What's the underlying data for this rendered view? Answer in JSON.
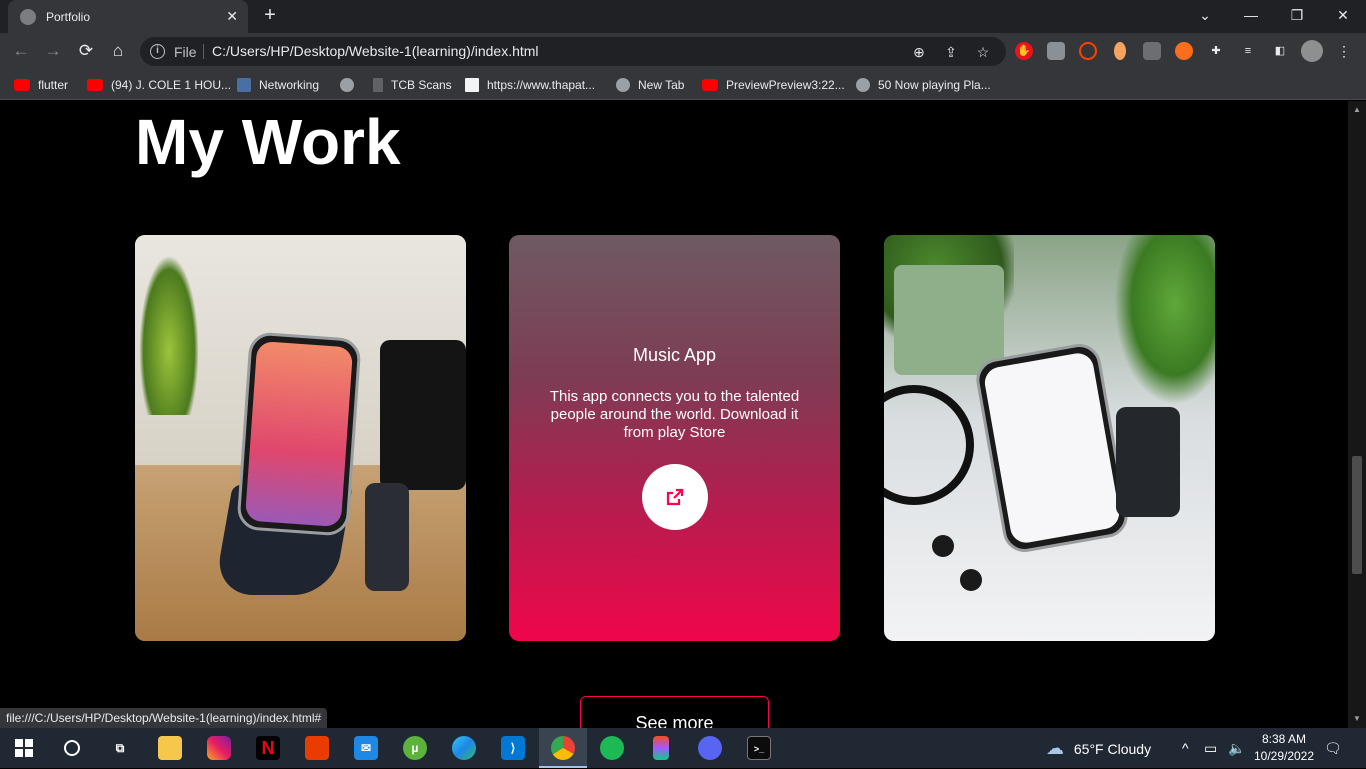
{
  "browser": {
    "tab_title": "Portfolio",
    "tab_close": "✕",
    "new_tab": "+",
    "address_security": "File",
    "address_url": "C:/Users/HP/Desktop/Website-1(learning)/index.html",
    "window_controls": {
      "dropdown": "⌄",
      "minimize": "—",
      "restore": "❐",
      "close": "✕"
    },
    "bookmarks": [
      {
        "label": "flutter",
        "icon": "youtube-icon"
      },
      {
        "label": "(94) J. COLE 1 HOU...",
        "icon": "youtube-icon"
      },
      {
        "label": "Networking",
        "icon": "network-icon"
      },
      {
        "label": "",
        "icon": "globe-icon"
      },
      {
        "label": "TCB Scans",
        "icon": "document-icon"
      },
      {
        "label": "https://www.thapat...",
        "icon": "page-icon"
      },
      {
        "label": "New Tab",
        "icon": "globe-icon"
      },
      {
        "label": "PreviewPreview3:22...",
        "icon": "youtube-icon"
      },
      {
        "label": "50 Now playing Pla...",
        "icon": "globe-icon"
      }
    ],
    "status_url": "file:///C:/Users/HP/Desktop/Website-1(learning)/index.html#"
  },
  "page": {
    "section_title": "My Work",
    "cards": [
      {
        "image": "phone-on-stand-image"
      },
      {
        "title": "Music App",
        "description": "This app connects you to the talented people around the world. Download it from play Store",
        "link_icon": "external-link-icon"
      },
      {
        "image": "store-app-phone-image"
      }
    ],
    "see_more": "See more"
  },
  "taskbar": {
    "weather": "65°F  Cloudy",
    "time": "8:38 AM",
    "date": "10/29/2022",
    "apps": [
      "windows-start-icon",
      "search-circle-icon",
      "task-view-icon",
      "file-explorer-icon",
      "instagram-icon",
      "netflix-icon",
      "office-icon",
      "mail-icon",
      "utorrent-icon",
      "edge-icon",
      "vscode-icon",
      "chrome-icon",
      "spotify-icon",
      "figma-icon",
      "discord-icon",
      "terminal-icon"
    ]
  },
  "colors": {
    "accent": "#ff004f",
    "background": "#000000",
    "chrome_dark": "#202124",
    "chrome_toolbar": "#35363a"
  }
}
